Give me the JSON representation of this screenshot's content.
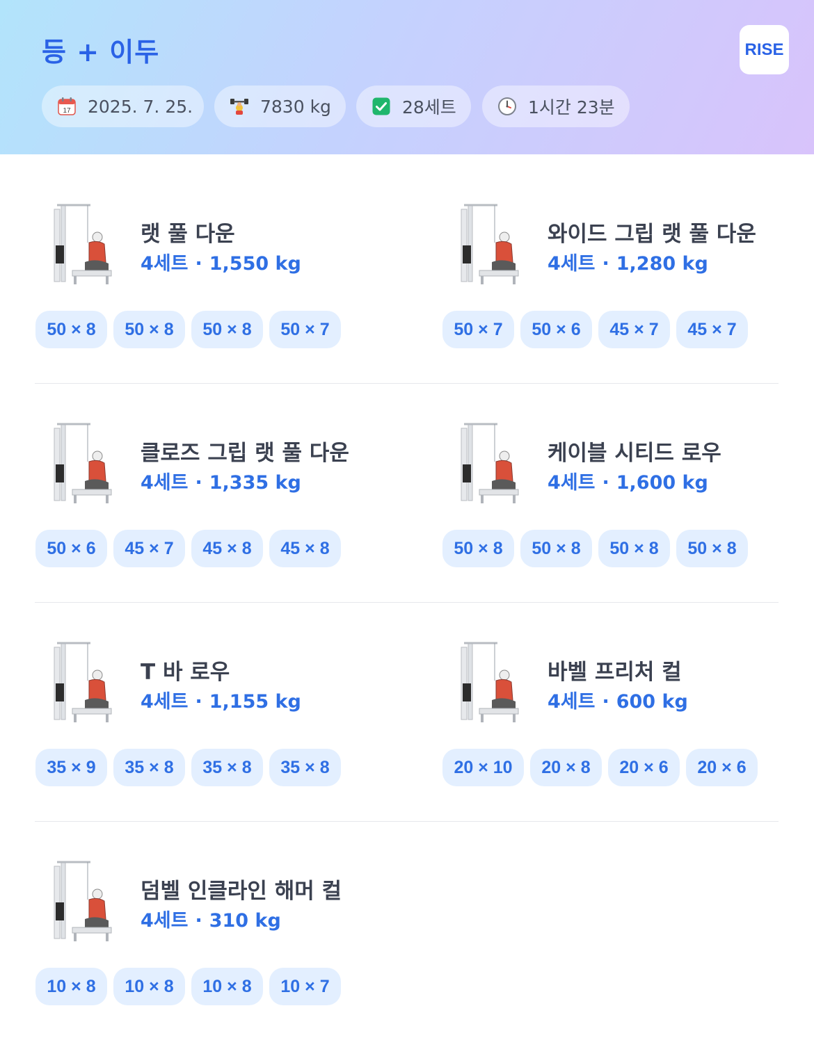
{
  "header": {
    "title": "등 + 이두",
    "logo": "RISE",
    "stats": [
      {
        "icon": "calendar-icon",
        "label": "2025. 7. 25."
      },
      {
        "icon": "dumbbell-icon",
        "label": "7830 kg"
      },
      {
        "icon": "checkbox-icon",
        "label": "28세트"
      },
      {
        "icon": "clock-icon",
        "label": "1시간 23분"
      }
    ]
  },
  "exercises": [
    {
      "name": "랫 풀 다운",
      "sets_label": "4세트",
      "volume": "1,550 kg",
      "icon": "lat-pulldown-illustration",
      "sets": [
        "50 × 8",
        "50 × 8",
        "50 × 8",
        "50 × 7"
      ]
    },
    {
      "name": "와이드 그립 랫 풀 다운",
      "sets_label": "4세트",
      "volume": "1,280 kg",
      "icon": "wide-grip-lat-pulldown-illustration",
      "sets": [
        "50 × 7",
        "50 × 6",
        "45 × 7",
        "45 × 7"
      ]
    },
    {
      "name": "클로즈 그립 랫 풀 다운",
      "sets_label": "4세트",
      "volume": "1,335 kg",
      "icon": "close-grip-lat-pulldown-illustration",
      "sets": [
        "50 × 6",
        "45 × 7",
        "45 × 8",
        "45 × 8"
      ]
    },
    {
      "name": "케이블 시티드 로우",
      "sets_label": "4세트",
      "volume": "1,600 kg",
      "icon": "cable-seated-row-illustration",
      "sets": [
        "50 × 8",
        "50 × 8",
        "50 × 8",
        "50 × 8"
      ]
    },
    {
      "name": "T 바 로우",
      "sets_label": "4세트",
      "volume": "1,155 kg",
      "icon": "t-bar-row-illustration",
      "sets": [
        "35 × 9",
        "35 × 8",
        "35 × 8",
        "35 × 8"
      ]
    },
    {
      "name": "바벨 프리처 컬",
      "sets_label": "4세트",
      "volume": "600 kg",
      "icon": "barbell-preacher-curl-illustration",
      "sets": [
        "20 × 10",
        "20 × 8",
        "20 × 6",
        "20 × 6"
      ]
    },
    {
      "name": "덤벨 인클라인 해머 컬",
      "sets_label": "4세트",
      "volume": "310 kg",
      "icon": "dumbbell-incline-hammer-curl-illustration",
      "sets": [
        "10 × 8",
        "10 × 8",
        "10 × 8",
        "10 × 7"
      ]
    }
  ],
  "colors": {
    "accent": "#2f6fe4",
    "chip_bg": "#e3efff",
    "muscle": "#d9503a"
  }
}
